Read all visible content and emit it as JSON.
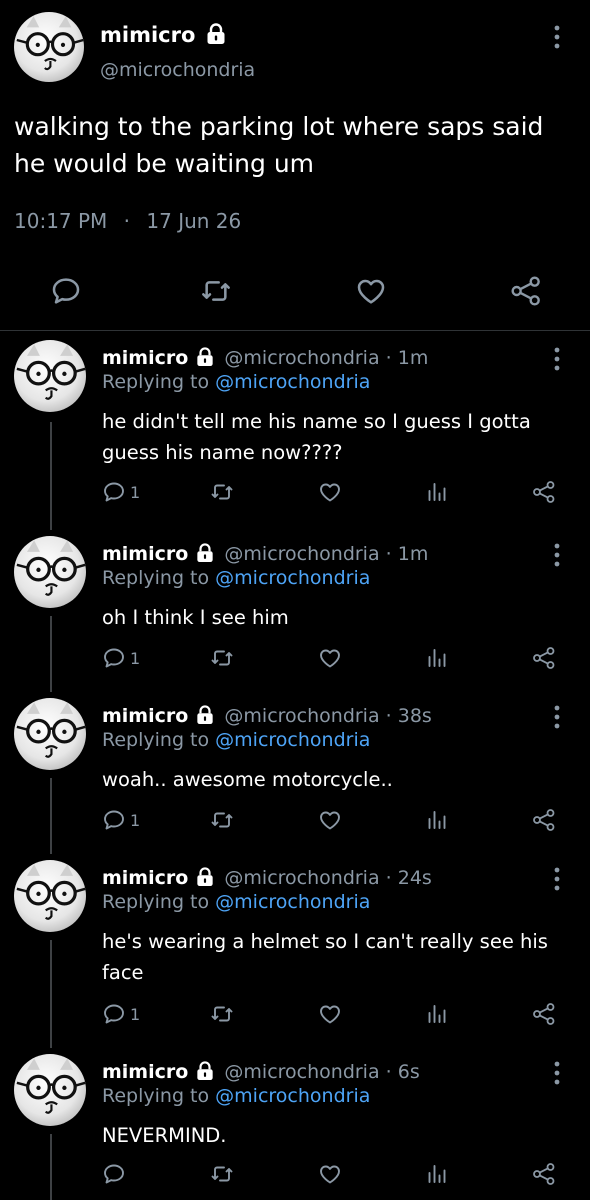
{
  "main_tweet": {
    "name": "mimicro",
    "handle": "@microchondria",
    "text": "walking to the parking lot where saps said he would be waiting um",
    "time": "10:17 PM",
    "sep": "·",
    "date": "17 Jun 26"
  },
  "replies": [
    {
      "name": "mimicro",
      "handle": "@microchondria",
      "age": "· 1m",
      "replying_label": "Replying to",
      "replying_to": "@microchondria",
      "text": "he didn't tell me his name so I guess I gotta guess his name now????",
      "reply_count": "1"
    },
    {
      "name": "mimicro",
      "handle": "@microchondria",
      "age": "· 1m",
      "replying_label": "Replying to",
      "replying_to": "@microchondria",
      "text": "oh I think I see him",
      "reply_count": "1"
    },
    {
      "name": "mimicro",
      "handle": "@microchondria",
      "age": "· 38s",
      "replying_label": "Replying to",
      "replying_to": "@microchondria",
      "text": "woah.. awesome motorcycle..",
      "reply_count": "1"
    },
    {
      "name": "mimicro",
      "handle": "@microchondria",
      "age": "· 24s",
      "replying_label": "Replying to",
      "replying_to": "@microchondria",
      "text": "he's wearing a helmet so I can't really see his face",
      "reply_count": "1"
    },
    {
      "name": "mimicro",
      "handle": "@microchondria",
      "age": "· 6s",
      "replying_label": "Replying to",
      "replying_to": "@microchondria",
      "text": "NEVERMIND.",
      "reply_count": ""
    }
  ],
  "icons": {
    "lock": "lock-icon",
    "reply": "reply-icon",
    "retweet": "retweet-icon",
    "like": "heart-icon",
    "views": "views-icon",
    "share": "share-icon",
    "more": "more-vertical-icon"
  },
  "colors": {
    "background": "#000000",
    "text": "#e7e9ea",
    "muted": "#8b98a5",
    "link": "#4ea4f6",
    "divider": "#2f3336"
  }
}
